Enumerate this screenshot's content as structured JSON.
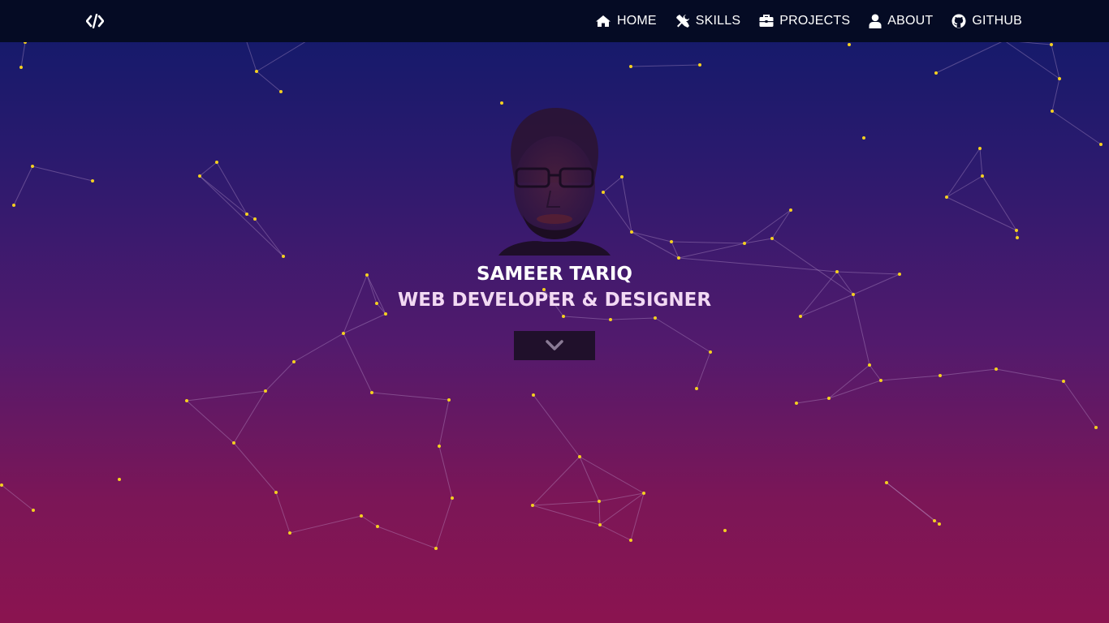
{
  "nav": {
    "brand_icon": "code-icon",
    "items": [
      {
        "label": "HOME",
        "icon": "home-icon"
      },
      {
        "label": "SKILLS",
        "icon": "tools-icon"
      },
      {
        "label": "PROJECTS",
        "icon": "briefcase-icon"
      },
      {
        "label": "ABOUT",
        "icon": "user-icon"
      },
      {
        "label": "GITHUB",
        "icon": "github-icon"
      }
    ]
  },
  "hero": {
    "name": "SAMEER TARIQ",
    "role": "WEB DEVELOPER & DESIGNER",
    "scroll_icon": "chevron-down-icon"
  },
  "colors": {
    "nav_bg": "#050b24",
    "gradient_top": "#0f1a6a",
    "gradient_bottom": "#8b1450",
    "particle": "#f5d020",
    "button_bg": "#20102b"
  }
}
